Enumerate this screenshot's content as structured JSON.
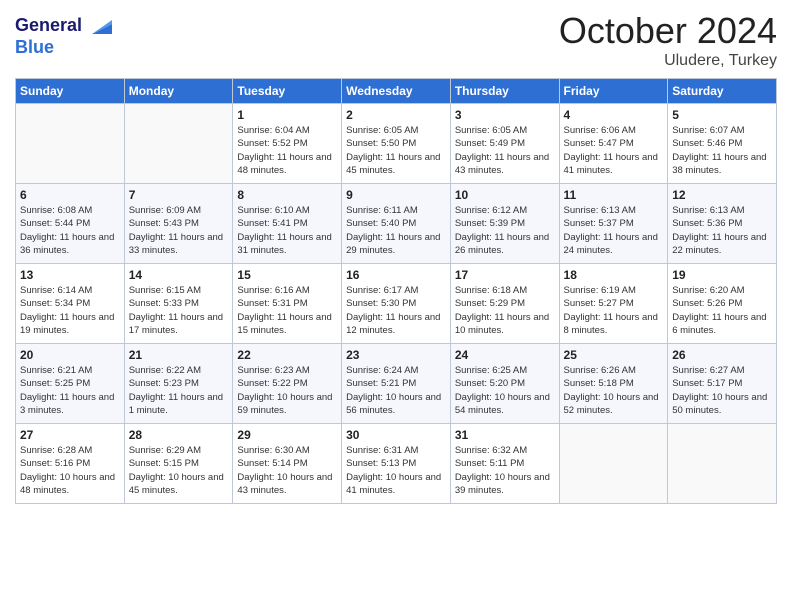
{
  "header": {
    "logo_line1": "General",
    "logo_line2": "Blue",
    "month": "October 2024",
    "location": "Uludere, Turkey"
  },
  "columns": [
    "Sunday",
    "Monday",
    "Tuesday",
    "Wednesday",
    "Thursday",
    "Friday",
    "Saturday"
  ],
  "weeks": [
    [
      {
        "day": "",
        "info": ""
      },
      {
        "day": "",
        "info": ""
      },
      {
        "day": "1",
        "info": "Sunrise: 6:04 AM\nSunset: 5:52 PM\nDaylight: 11 hours and 48 minutes."
      },
      {
        "day": "2",
        "info": "Sunrise: 6:05 AM\nSunset: 5:50 PM\nDaylight: 11 hours and 45 minutes."
      },
      {
        "day": "3",
        "info": "Sunrise: 6:05 AM\nSunset: 5:49 PM\nDaylight: 11 hours and 43 minutes."
      },
      {
        "day": "4",
        "info": "Sunrise: 6:06 AM\nSunset: 5:47 PM\nDaylight: 11 hours and 41 minutes."
      },
      {
        "day": "5",
        "info": "Sunrise: 6:07 AM\nSunset: 5:46 PM\nDaylight: 11 hours and 38 minutes."
      }
    ],
    [
      {
        "day": "6",
        "info": "Sunrise: 6:08 AM\nSunset: 5:44 PM\nDaylight: 11 hours and 36 minutes."
      },
      {
        "day": "7",
        "info": "Sunrise: 6:09 AM\nSunset: 5:43 PM\nDaylight: 11 hours and 33 minutes."
      },
      {
        "day": "8",
        "info": "Sunrise: 6:10 AM\nSunset: 5:41 PM\nDaylight: 11 hours and 31 minutes."
      },
      {
        "day": "9",
        "info": "Sunrise: 6:11 AM\nSunset: 5:40 PM\nDaylight: 11 hours and 29 minutes."
      },
      {
        "day": "10",
        "info": "Sunrise: 6:12 AM\nSunset: 5:39 PM\nDaylight: 11 hours and 26 minutes."
      },
      {
        "day": "11",
        "info": "Sunrise: 6:13 AM\nSunset: 5:37 PM\nDaylight: 11 hours and 24 minutes."
      },
      {
        "day": "12",
        "info": "Sunrise: 6:13 AM\nSunset: 5:36 PM\nDaylight: 11 hours and 22 minutes."
      }
    ],
    [
      {
        "day": "13",
        "info": "Sunrise: 6:14 AM\nSunset: 5:34 PM\nDaylight: 11 hours and 19 minutes."
      },
      {
        "day": "14",
        "info": "Sunrise: 6:15 AM\nSunset: 5:33 PM\nDaylight: 11 hours and 17 minutes."
      },
      {
        "day": "15",
        "info": "Sunrise: 6:16 AM\nSunset: 5:31 PM\nDaylight: 11 hours and 15 minutes."
      },
      {
        "day": "16",
        "info": "Sunrise: 6:17 AM\nSunset: 5:30 PM\nDaylight: 11 hours and 12 minutes."
      },
      {
        "day": "17",
        "info": "Sunrise: 6:18 AM\nSunset: 5:29 PM\nDaylight: 11 hours and 10 minutes."
      },
      {
        "day": "18",
        "info": "Sunrise: 6:19 AM\nSunset: 5:27 PM\nDaylight: 11 hours and 8 minutes."
      },
      {
        "day": "19",
        "info": "Sunrise: 6:20 AM\nSunset: 5:26 PM\nDaylight: 11 hours and 6 minutes."
      }
    ],
    [
      {
        "day": "20",
        "info": "Sunrise: 6:21 AM\nSunset: 5:25 PM\nDaylight: 11 hours and 3 minutes."
      },
      {
        "day": "21",
        "info": "Sunrise: 6:22 AM\nSunset: 5:23 PM\nDaylight: 11 hours and 1 minute."
      },
      {
        "day": "22",
        "info": "Sunrise: 6:23 AM\nSunset: 5:22 PM\nDaylight: 10 hours and 59 minutes."
      },
      {
        "day": "23",
        "info": "Sunrise: 6:24 AM\nSunset: 5:21 PM\nDaylight: 10 hours and 56 minutes."
      },
      {
        "day": "24",
        "info": "Sunrise: 6:25 AM\nSunset: 5:20 PM\nDaylight: 10 hours and 54 minutes."
      },
      {
        "day": "25",
        "info": "Sunrise: 6:26 AM\nSunset: 5:18 PM\nDaylight: 10 hours and 52 minutes."
      },
      {
        "day": "26",
        "info": "Sunrise: 6:27 AM\nSunset: 5:17 PM\nDaylight: 10 hours and 50 minutes."
      }
    ],
    [
      {
        "day": "27",
        "info": "Sunrise: 6:28 AM\nSunset: 5:16 PM\nDaylight: 10 hours and 48 minutes."
      },
      {
        "day": "28",
        "info": "Sunrise: 6:29 AM\nSunset: 5:15 PM\nDaylight: 10 hours and 45 minutes."
      },
      {
        "day": "29",
        "info": "Sunrise: 6:30 AM\nSunset: 5:14 PM\nDaylight: 10 hours and 43 minutes."
      },
      {
        "day": "30",
        "info": "Sunrise: 6:31 AM\nSunset: 5:13 PM\nDaylight: 10 hours and 41 minutes."
      },
      {
        "day": "31",
        "info": "Sunrise: 6:32 AM\nSunset: 5:11 PM\nDaylight: 10 hours and 39 minutes."
      },
      {
        "day": "",
        "info": ""
      },
      {
        "day": "",
        "info": ""
      }
    ]
  ]
}
